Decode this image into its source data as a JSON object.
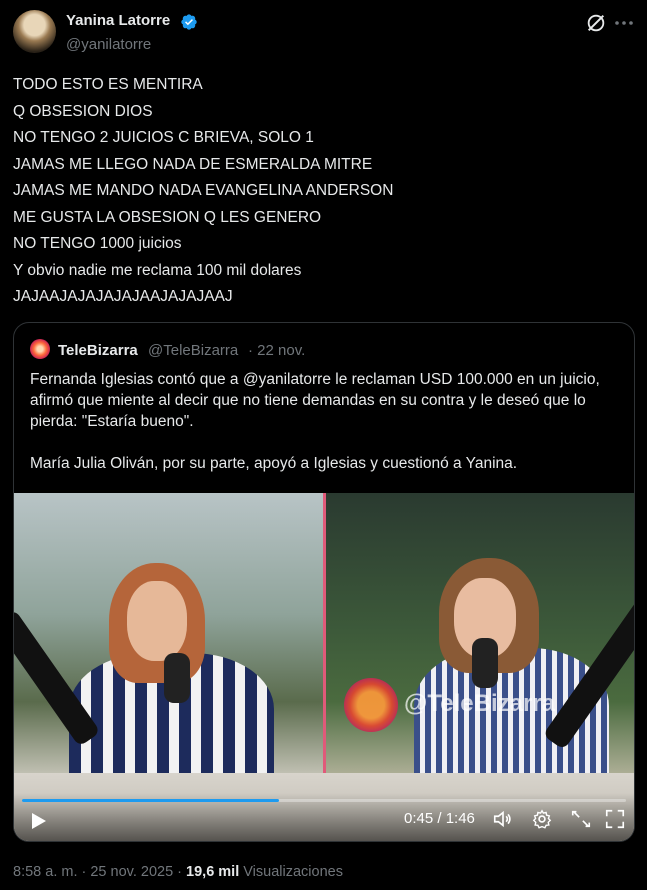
{
  "author": {
    "display_name": "Yanina Latorre",
    "handle": "@yanilatorre",
    "verified": true,
    "verified_color": "#1d9bf0"
  },
  "icons": {
    "grok": "grok-icon",
    "more": "more-icon"
  },
  "tweet": {
    "lines": [
      "TODO ESTO ES MENTIRA",
      "Q OBSESION DIOS",
      "NO TENGO 2 JUICIOS C BRIEVA, SOLO 1",
      "JAMAS ME LLEGO NADA DE ESMERALDA MITRE",
      "JAMAS ME MANDO NADA EVANGELINA ANDERSON",
      "ME GUSTA LA OBSESION Q LES GENERO",
      "NO TENGO 1000 juicios",
      "Y obvio nadie me reclama 100 mil dolares",
      "JAJAAJAJAJAJAJAAJAJAJAAJ"
    ]
  },
  "quote": {
    "name": "TeleBizarra",
    "handle": "@TeleBizarra",
    "date": "· 22 nov.",
    "paragraph_1": "Fernanda Iglesias contó que a @yanilatorre le reclaman USD 100.000 en un juicio, afirmó que miente al decir que no tiene demandas en su contra y le deseó que lo pierda: \"Estaría bueno\".",
    "paragraph_2": "María Julia Oliván, por su parte, apoyó a Iglesias y cuestionó a Yanina."
  },
  "video": {
    "watermark": "@TeleBizarra",
    "time": "0:45 / 1:46",
    "progress_fraction": 0.425,
    "controls": [
      "play-icon",
      "volume-icon",
      "settings-icon",
      "pip-icon",
      "fullscreen-icon"
    ]
  },
  "footer": {
    "time_date": "8:58 a. m. · 25 nov. 2025 ·",
    "views_count": "19,6 mil",
    "views_label": "Visualizaciones"
  }
}
